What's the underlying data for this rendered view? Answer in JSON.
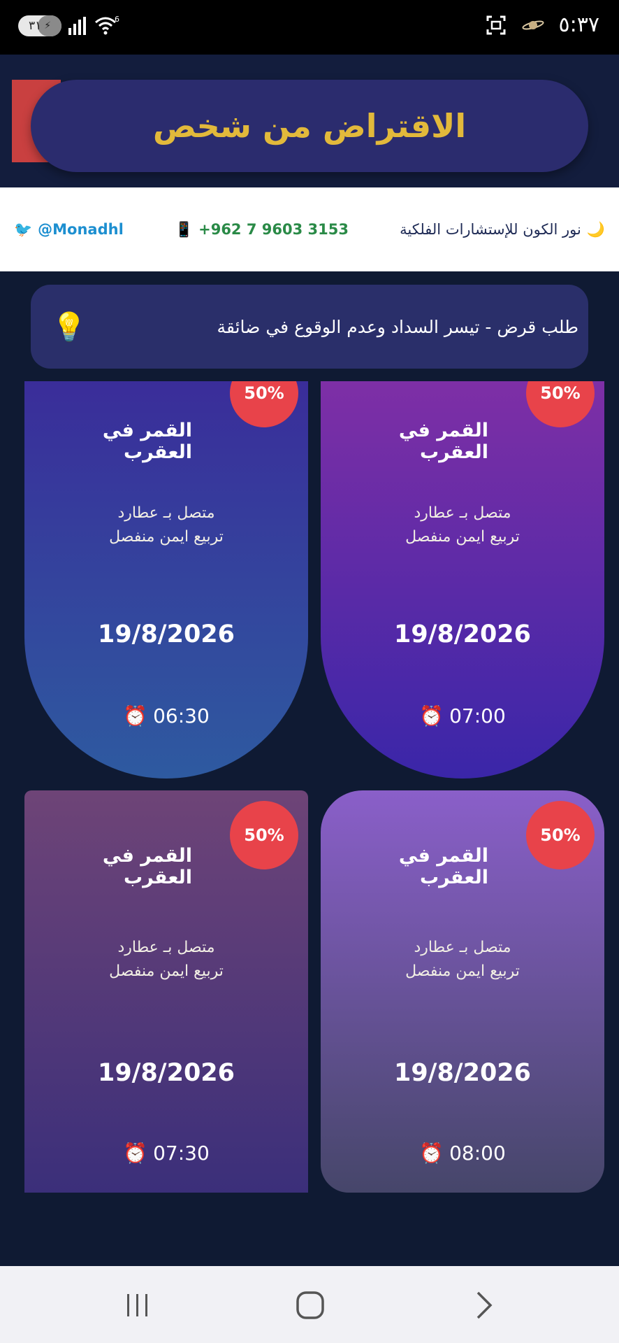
{
  "status_bar": {
    "time": "٥:٣٧",
    "battery_level": "٣١",
    "wifi_badge": "6",
    "icons": [
      "battery-charging-icon",
      "signal-icon",
      "wifi-icon",
      "screenshot-icon",
      "saturn-icon"
    ]
  },
  "header": {
    "title": "الاقتراض من شخص"
  },
  "info_strip": {
    "twitter_handle": "@Monadhl",
    "twitter_icon": "🐦",
    "phone": "+962 7 9603 3153",
    "phone_icon": "📱",
    "brand": "نور الكون للإستشارات الفلكية",
    "moon_icon": "🌙"
  },
  "tip": {
    "text": "طلب قرض - تيسر السداد وعدم الوقوع في ضائقة",
    "icon": "💡"
  },
  "cards": [
    {
      "title": "القمر في العقرب",
      "badge": "50%",
      "line1": "متصل بـ عطارد",
      "line2": "تربيع ايمن منفصل",
      "date": "19/8/2026",
      "time_icon": "⏰",
      "time": "07:00",
      "gradient": [
        "#7e2fa6",
        "#3a26a8"
      ]
    },
    {
      "title": "القمر في العقرب",
      "badge": "50%",
      "line1": "متصل بـ عطارد",
      "line2": "تربيع ايمن منفصل",
      "date": "19/8/2026",
      "time_icon": "⏰",
      "time": "06:30",
      "gradient": [
        "#3a2d9a",
        "#2e5aa0"
      ]
    },
    {
      "title": "القمر في العقرب",
      "badge": "50%",
      "line1": "متصل بـ عطارد",
      "line2": "تربيع ايمن منفصل",
      "date": "19/8/2026",
      "time_icon": "⏰",
      "time": "08:00",
      "gradient": [
        "#8a5fc9",
        "#46466a"
      ]
    },
    {
      "title": "القمر في العقرب",
      "badge": "50%",
      "line1": "متصل بـ عطارد",
      "line2": "تربيع ايمن منفصل",
      "date": "19/8/2026",
      "time_icon": "⏰",
      "time": "07:30",
      "gradient": [
        "#6e4477",
        "#3b2f7a"
      ]
    }
  ],
  "colors": {
    "page_bg": "#0f1a33",
    "title_gold": "#e2b93b",
    "badge_red": "#e8434a"
  }
}
